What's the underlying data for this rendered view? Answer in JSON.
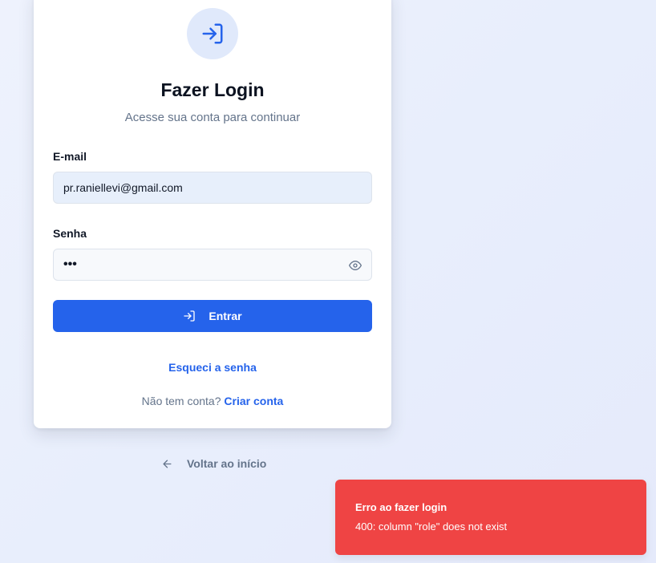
{
  "login": {
    "title": "Fazer Login",
    "subtitle": "Acesse sua conta para continuar",
    "email_label": "E-mail",
    "email_value": "pr.raniellevi@gmail.com",
    "password_label": "Senha",
    "password_value_masked": "•••",
    "submit_label": "Entrar",
    "forgot_label": "Esqueci a senha",
    "no_account_text": "Não tem conta?",
    "signup_label": "Criar conta"
  },
  "back_link": {
    "label": "Voltar ao início"
  },
  "toast": {
    "title": "Erro ao fazer login",
    "message": "400: column \"role\" does not exist",
    "color": "#ef4444"
  },
  "colors": {
    "accent": "#2563eb",
    "logo_bg": "#e0e9fb"
  },
  "icons": {
    "logo": "login-arrow-icon",
    "eye": "eye-icon",
    "button": "login-arrow-icon",
    "back": "arrow-left-icon"
  }
}
